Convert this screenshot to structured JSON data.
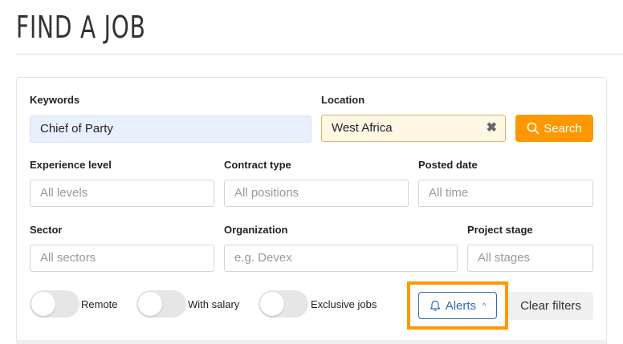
{
  "page": {
    "title": "FIND A JOB"
  },
  "filters": {
    "keywords": {
      "label": "Keywords",
      "value": "Chief of Party"
    },
    "location": {
      "label": "Location",
      "value": "West Africa",
      "clear_glyph": "✖"
    },
    "search_button": {
      "label": "Search",
      "icon": "search-icon"
    },
    "experience": {
      "label": "Experience level",
      "placeholder": "All levels"
    },
    "contract": {
      "label": "Contract type",
      "placeholder": "All positions"
    },
    "posted": {
      "label": "Posted date",
      "placeholder": "All time"
    },
    "sector": {
      "label": "Sector",
      "placeholder": "All sectors"
    },
    "organization": {
      "label": "Organization",
      "placeholder": "e.g. Devex"
    },
    "project_stage": {
      "label": "Project stage",
      "placeholder": "All stages"
    }
  },
  "toggles": [
    {
      "label": "Remote",
      "on": false
    },
    {
      "label": "With salary",
      "on": false
    },
    {
      "label": "Exclusive jobs",
      "on": false
    }
  ],
  "actions": {
    "alerts": {
      "label": "Alerts",
      "icon": "bell-icon",
      "chevron": "^"
    },
    "clear": {
      "label": "Clear filters"
    }
  },
  "colors": {
    "accent": "#ff9800",
    "link_blue": "#2b6cb0"
  }
}
